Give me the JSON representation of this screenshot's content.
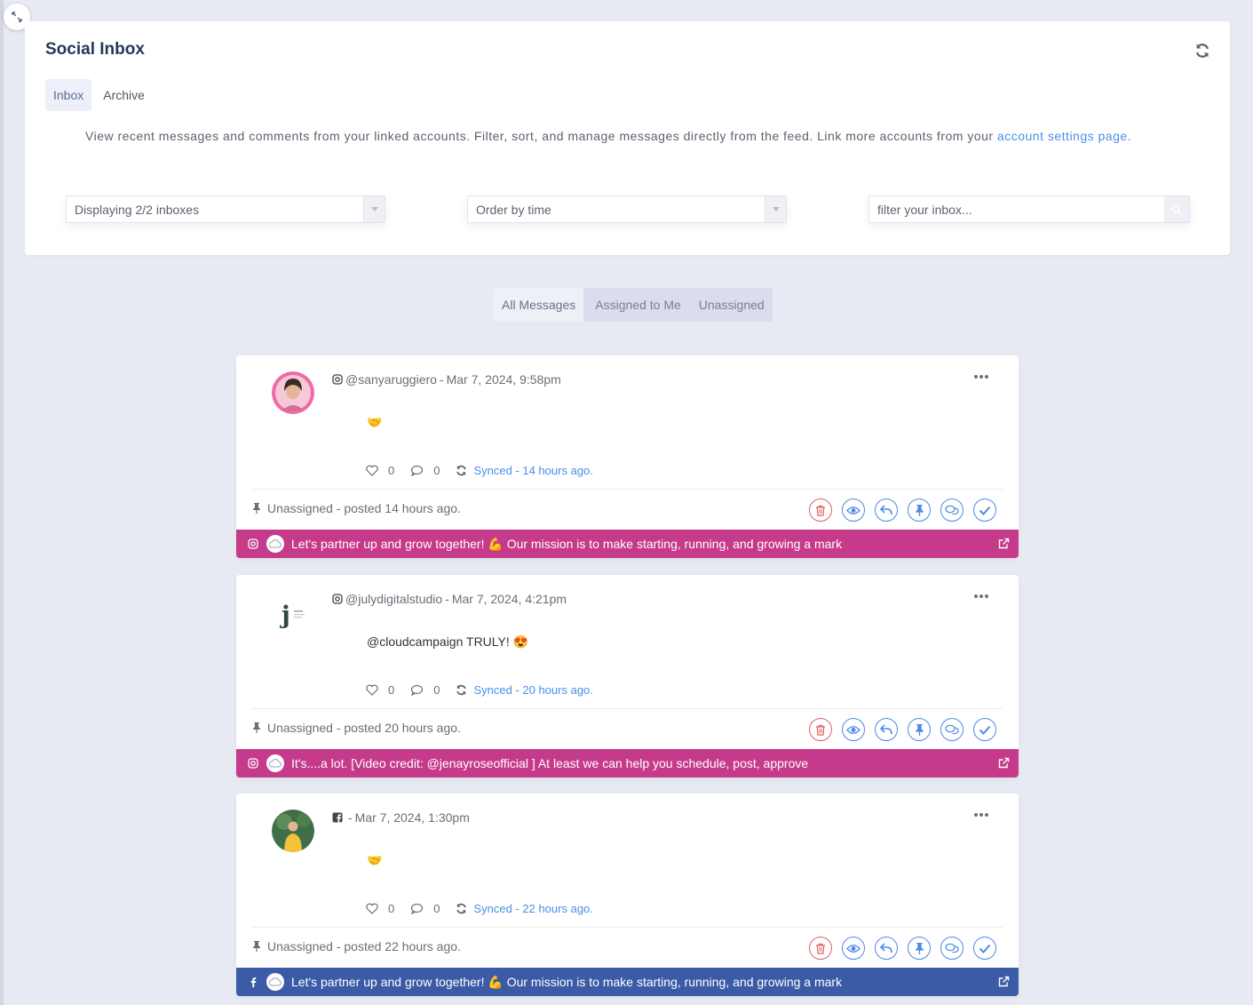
{
  "colors": {
    "accent": "#4a8fe7",
    "instagram_bar": "#c63a8b",
    "facebook_bar": "#3b5ba6",
    "delete": "#df6262"
  },
  "header": {
    "title": "Social Inbox"
  },
  "tabs": [
    {
      "label": "Inbox"
    },
    {
      "label": "Archive"
    }
  ],
  "description": {
    "text": "View recent messages and comments from your linked accounts. Filter, sort, and manage messages directly from the feed. Link more accounts from your",
    "link": "account settings page."
  },
  "controls": {
    "inboxes": "Displaying 2/2 inboxes",
    "order": "Order by time",
    "search_placeholder": "filter your inbox..."
  },
  "filters": [
    {
      "label": "All Messages"
    },
    {
      "label": "Assigned to Me"
    },
    {
      "label": "Unassigned"
    }
  ],
  "messages": [
    {
      "network": "instagram",
      "author": "@sanyaruggiero",
      "sep": "-",
      "date": "Mar 7, 2024, 9:58pm",
      "text": "🤝",
      "likes": "0",
      "comments": "0",
      "synced": "Synced - 14 hours ago.",
      "assignment": "Unassigned - posted 14 hours ago.",
      "post": "Let's partner up and grow together! 💪 Our mission is to make starting, running, and growing a mark"
    },
    {
      "network": "instagram",
      "author": "@julydigitalstudio",
      "sep": "-",
      "date": "Mar 7, 2024, 4:21pm",
      "text": "@cloudcampaign TRULY! 😍",
      "likes": "0",
      "comments": "0",
      "synced": "Synced - 20 hours ago.",
      "assignment": "Unassigned - posted 20 hours ago.",
      "post": "It's....a lot. [Video credit: @jenayroseofficial ] At least we can help you schedule, post, approve"
    },
    {
      "network": "facebook",
      "author": "",
      "sep": "-",
      "date": "Mar 7, 2024, 1:30pm",
      "text": "🤝",
      "likes": "0",
      "comments": "0",
      "synced": "Synced - 22 hours ago.",
      "assignment": "Unassigned - posted 22 hours ago.",
      "post": "Let's partner up and grow together! 💪 Our mission is to make starting, running, and growing a mark"
    }
  ]
}
